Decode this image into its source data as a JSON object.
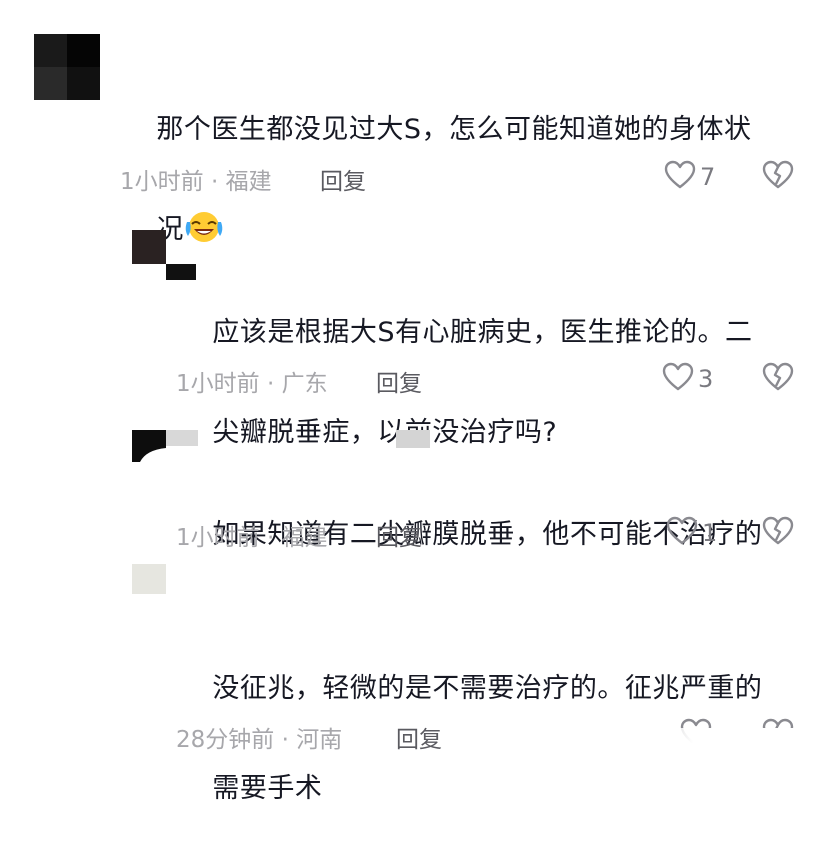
{
  "comments": [
    {
      "text_line1": "那个医生都没见过大S，怎么可能知道她的身体状",
      "text_line2": "况",
      "emoji": "crying-laughing-emoji",
      "time": "1小时前",
      "location": "福建",
      "reply_label": "回复",
      "likes": "7"
    },
    {
      "text_line1": "应该是根据大S有心脏病史，医生推论的。二",
      "text_line2": "尖瓣脱垂症，以前没治疗吗?",
      "time": "1小时前",
      "location": "广东",
      "reply_label": "回复",
      "likes": "3"
    },
    {
      "text_line1": "如果知道有二尖瓣膜脱垂，他不可能不治疗的",
      "time": "1小时前",
      "location": "福建",
      "reply_label": "回复",
      "likes": "1"
    },
    {
      "text_line1": "没征兆，轻微的是不需要治疗的。征兆严重的",
      "text_line2": "需要手术",
      "time": "28分钟前",
      "location": "河南",
      "reply_label": "回复"
    }
  ],
  "separator": "·",
  "colors": {
    "text": "#161823",
    "meta": "#a7a7ab",
    "icon": "#8a8a90"
  }
}
